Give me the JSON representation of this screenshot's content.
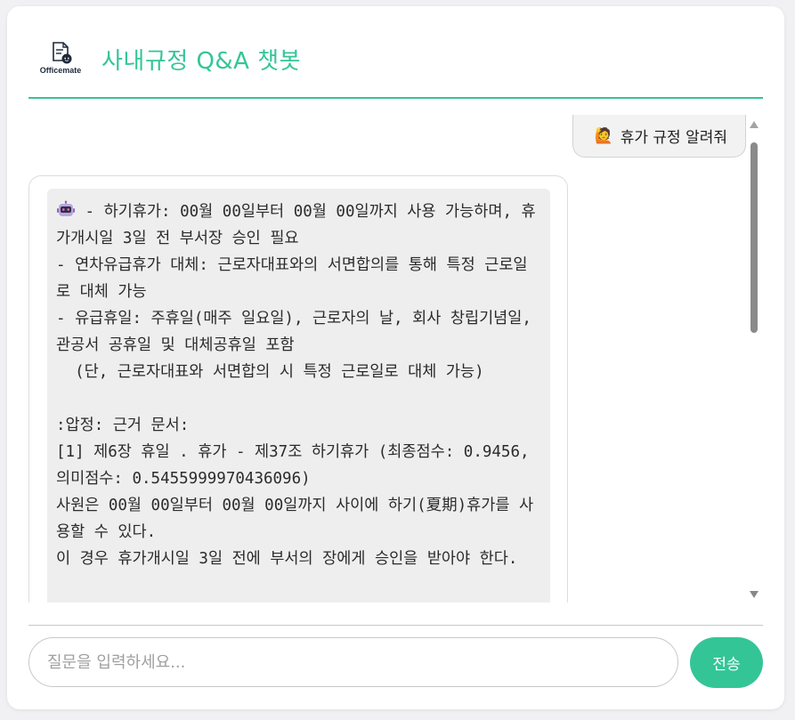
{
  "header": {
    "logo_text": "Officemate",
    "title": "사내규정 Q&A 챗봇"
  },
  "chat": {
    "user_message": {
      "icon": "🙋",
      "text": "휴가 규정 알려줘"
    },
    "bot_message": {
      "icon": "robot-icon",
      "text": " - 하기휴가: 00월 00일부터 00월 00일까지 사용 가능하며, 휴가개시일 3일 전 부서장 승인 필요\n- 연차유급휴가 대체: 근로자대표와의 서면합의를 통해 특정 근로일로 대체 가능\n- 유급휴일: 주휴일(매주 일요일), 근로자의 날, 회사 창립기념일, 관공서 공휴일 및 대체공휴일 포함\n  (단, 근로자대표와 서면합의 시 특정 근로일로 대체 가능)\n\n:압정: 근거 문서:\n[1] 제6장 휴일 . 휴가 - 제37조 하기휴가 (최종점수: 0.9456, 의미점수: 0.5455999970436096)\n사원은 00월 00일부터 00월 00일까지 사이에 하기(夏期)휴가를 사용할 수 있다.\n이 경우 휴가개시일 3일 전에 부서의 장에게 승인을 받아야 한다."
    }
  },
  "input": {
    "placeholder": "질문을 입력하세요...",
    "value": ""
  },
  "send_button_label": "전송",
  "colors": {
    "accent": "#34c597",
    "bot_bubble": "#eeeeee",
    "user_bubble": "#f2f2f2"
  }
}
